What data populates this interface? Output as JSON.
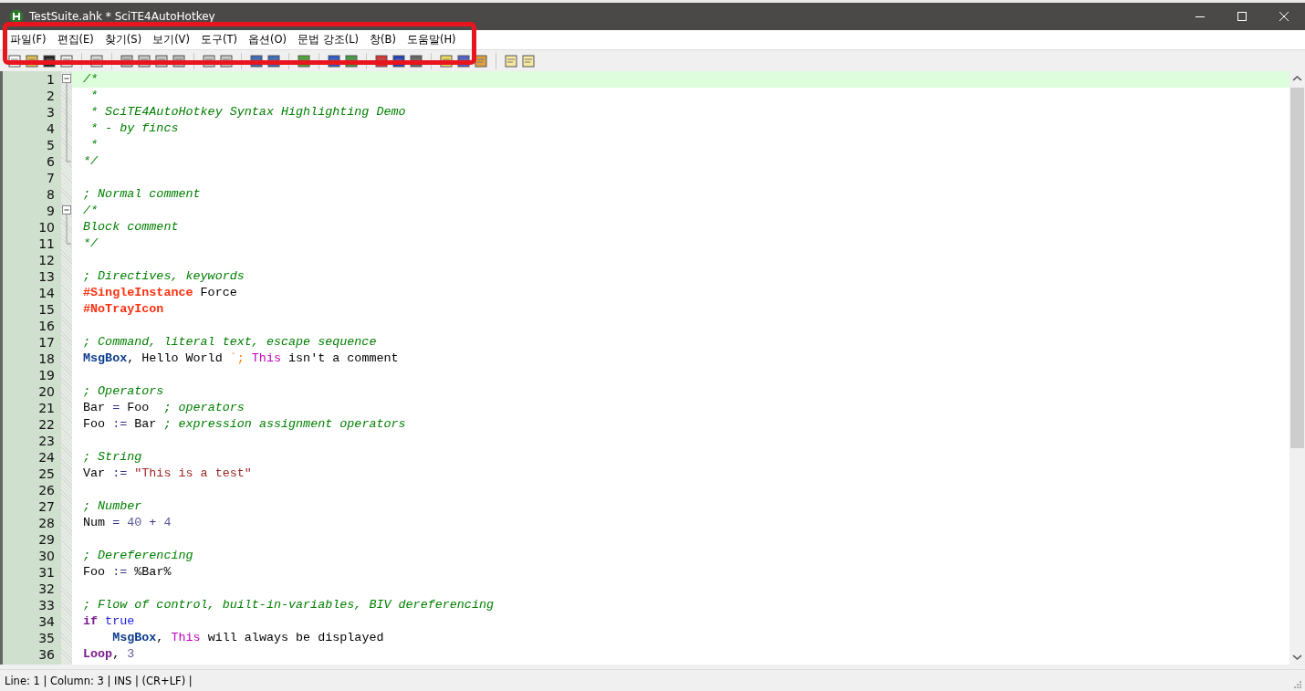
{
  "window": {
    "title": "TestSuite.ahk * SciTE4AutoHotkey"
  },
  "menu": [
    "파일(F)",
    "편집(E)",
    "찾기(S)",
    "보기(V)",
    "도구(T)",
    "옵션(O)",
    "문법 강조(L)",
    "창(B)",
    "도움말(H)"
  ],
  "editor": {
    "lines": [
      {
        "number": "1",
        "current": true,
        "fold_toggle": true,
        "in_fold": false,
        "tokens": [
          {
            "kind": "comment",
            "text": "/*"
          }
        ]
      },
      {
        "number": "2",
        "current": false,
        "fold_toggle": false,
        "in_fold": true,
        "tokens": [
          {
            "kind": "comment",
            "text": " *"
          }
        ]
      },
      {
        "number": "3",
        "current": false,
        "fold_toggle": false,
        "in_fold": true,
        "tokens": [
          {
            "kind": "comment",
            "text": " * SciTE4AutoHotkey Syntax Highlighting Demo"
          }
        ]
      },
      {
        "number": "4",
        "current": false,
        "fold_toggle": false,
        "in_fold": true,
        "tokens": [
          {
            "kind": "comment",
            "text": " * - by fincs"
          }
        ]
      },
      {
        "number": "5",
        "current": false,
        "fold_toggle": false,
        "in_fold": true,
        "tokens": [
          {
            "kind": "comment",
            "text": " *"
          }
        ]
      },
      {
        "number": "6",
        "current": false,
        "fold_toggle": false,
        "in_fold": true,
        "tokens": [
          {
            "kind": "comment",
            "text": "*/"
          }
        ]
      },
      {
        "number": "7",
        "current": false,
        "fold_toggle": false,
        "in_fold": false
      },
      {
        "number": "8",
        "current": false,
        "fold_toggle": false,
        "in_fold": false,
        "tokens": [
          {
            "kind": "comment",
            "text": "; Normal comment"
          }
        ]
      },
      {
        "number": "9",
        "current": false,
        "fold_toggle": true,
        "in_fold": false,
        "tokens": [
          {
            "kind": "comment",
            "text": "/*"
          }
        ]
      },
      {
        "number": "10",
        "current": false,
        "fold_toggle": false,
        "in_fold": true,
        "tokens": [
          {
            "kind": "comment",
            "text": "Block comment"
          }
        ]
      },
      {
        "number": "11",
        "current": false,
        "fold_toggle": false,
        "in_fold": true,
        "tokens": [
          {
            "kind": "comment",
            "text": "*/"
          }
        ]
      },
      {
        "number": "12",
        "current": false,
        "fold_toggle": false,
        "in_fold": false
      },
      {
        "number": "13",
        "current": false,
        "fold_toggle": false,
        "in_fold": false,
        "tokens": [
          {
            "kind": "comment",
            "text": "; Directives, keywords"
          }
        ]
      },
      {
        "number": "14",
        "current": false,
        "fold_toggle": false,
        "in_fold": false,
        "tokens": [
          {
            "kind": "directive",
            "text": "#SingleInstance"
          },
          {
            "kind": "plain",
            "text": " Force"
          }
        ]
      },
      {
        "number": "15",
        "current": false,
        "fold_toggle": false,
        "in_fold": false,
        "tokens": [
          {
            "kind": "directive",
            "text": "#NoTrayIcon"
          }
        ]
      },
      {
        "number": "16",
        "current": false,
        "fold_toggle": false,
        "in_fold": false
      },
      {
        "number": "17",
        "current": false,
        "fold_toggle": false,
        "in_fold": false,
        "tokens": [
          {
            "kind": "comment",
            "text": "; Command, literal text, escape sequence"
          }
        ]
      },
      {
        "number": "18",
        "current": false,
        "fold_toggle": false,
        "in_fold": false,
        "tokens": [
          {
            "kind": "command",
            "text": "MsgBox"
          },
          {
            "kind": "plain",
            "text": ", Hello World "
          },
          {
            "kind": "escape",
            "text": "`; "
          },
          {
            "kind": "variable",
            "text": "This"
          },
          {
            "kind": "plain",
            "text": " isn't a comment"
          }
        ]
      },
      {
        "number": "19",
        "current": false,
        "fold_toggle": false,
        "in_fold": false
      },
      {
        "number": "20",
        "current": false,
        "fold_toggle": false,
        "in_fold": false,
        "tokens": [
          {
            "kind": "comment",
            "text": "; Operators"
          }
        ]
      },
      {
        "number": "21",
        "current": false,
        "fold_toggle": false,
        "in_fold": false,
        "tokens": [
          {
            "kind": "plain",
            "text": "Bar "
          },
          {
            "kind": "operator",
            "text": "="
          },
          {
            "kind": "plain",
            "text": " Foo  "
          },
          {
            "kind": "comment",
            "text": "; operators"
          }
        ]
      },
      {
        "number": "22",
        "current": false,
        "fold_toggle": false,
        "in_fold": false,
        "tokens": [
          {
            "kind": "plain",
            "text": "Foo "
          },
          {
            "kind": "operator",
            "text": ":="
          },
          {
            "kind": "plain",
            "text": " Bar "
          },
          {
            "kind": "comment",
            "text": "; expression assignment operators"
          }
        ]
      },
      {
        "number": "23",
        "current": false,
        "fold_toggle": false,
        "in_fold": false
      },
      {
        "number": "24",
        "current": false,
        "fold_toggle": false,
        "in_fold": false,
        "tokens": [
          {
            "kind": "comment",
            "text": "; String"
          }
        ]
      },
      {
        "number": "25",
        "current": false,
        "fold_toggle": false,
        "in_fold": false,
        "tokens": [
          {
            "kind": "plain",
            "text": "Var "
          },
          {
            "kind": "operator",
            "text": ":= "
          },
          {
            "kind": "string",
            "text": "\"This is a test\""
          }
        ]
      },
      {
        "number": "26",
        "current": false,
        "fold_toggle": false,
        "in_fold": false
      },
      {
        "number": "27",
        "current": false,
        "fold_toggle": false,
        "in_fold": false,
        "tokens": [
          {
            "kind": "comment",
            "text": "; Number"
          }
        ]
      },
      {
        "number": "28",
        "current": false,
        "fold_toggle": false,
        "in_fold": false,
        "tokens": [
          {
            "kind": "plain",
            "text": "Num "
          },
          {
            "kind": "operator",
            "text": "= "
          },
          {
            "kind": "number",
            "text": "40 "
          },
          {
            "kind": "operator",
            "text": "+ "
          },
          {
            "kind": "number",
            "text": "4"
          }
        ]
      },
      {
        "number": "29",
        "current": false,
        "fold_toggle": false,
        "in_fold": false
      },
      {
        "number": "30",
        "current": false,
        "fold_toggle": false,
        "in_fold": false,
        "tokens": [
          {
            "kind": "comment",
            "text": "; Dereferencing"
          }
        ]
      },
      {
        "number": "31",
        "current": false,
        "fold_toggle": false,
        "in_fold": false,
        "tokens": [
          {
            "kind": "plain",
            "text": "Foo "
          },
          {
            "kind": "operator",
            "text": ":="
          },
          {
            "kind": "plain",
            "text": " %Bar%"
          }
        ]
      },
      {
        "number": "32",
        "current": false,
        "fold_toggle": false,
        "in_fold": false
      },
      {
        "number": "33",
        "current": false,
        "fold_toggle": false,
        "in_fold": false,
        "tokens": [
          {
            "kind": "comment",
            "text": "; Flow of control, built-in-variables, BIV dereferencing"
          }
        ]
      },
      {
        "number": "34",
        "current": false,
        "fold_toggle": false,
        "in_fold": false,
        "tokens": [
          {
            "kind": "flow",
            "text": "if "
          },
          {
            "kind": "builtin",
            "text": "true"
          }
        ]
      },
      {
        "number": "35",
        "current": false,
        "fold_toggle": false,
        "in_fold": false,
        "tokens": [
          {
            "kind": "command",
            "text": "    MsgBox"
          },
          {
            "kind": "plain",
            "text": ", "
          },
          {
            "kind": "variable",
            "text": "This"
          },
          {
            "kind": "plain",
            "text": " will always be displayed"
          }
        ]
      },
      {
        "number": "36",
        "current": false,
        "fold_toggle": false,
        "in_fold": false,
        "tokens": [
          {
            "kind": "flow",
            "text": "Loop"
          },
          {
            "kind": "plain",
            "text": ", "
          },
          {
            "kind": "number",
            "text": "3"
          }
        ]
      }
    ]
  },
  "status_bar": "Line: 1 | Column: 3 | INS | (CR+LF) |"
}
